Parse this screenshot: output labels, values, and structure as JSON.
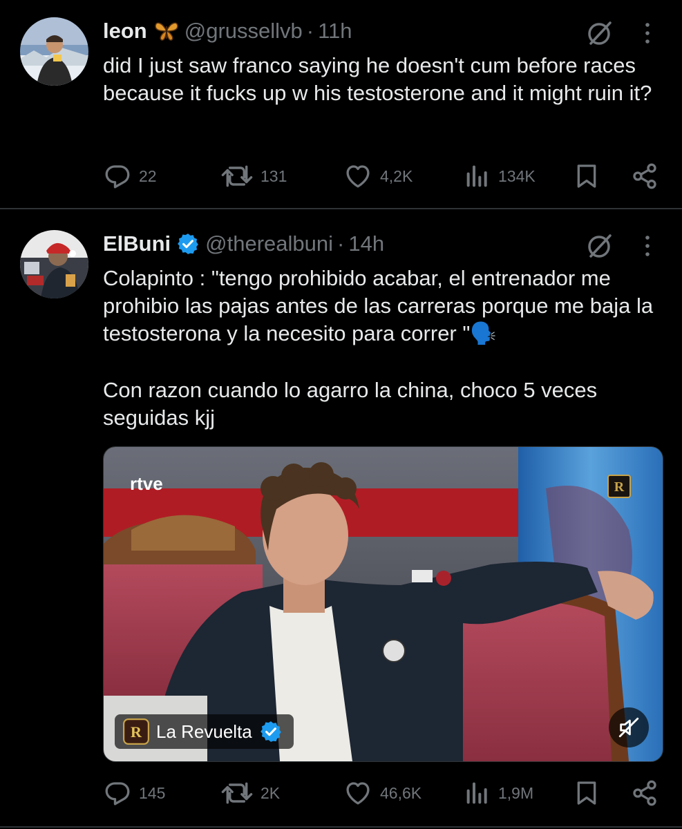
{
  "tweets": [
    {
      "author_name": "leon",
      "handle": "@grussellvb",
      "separator": "·",
      "time": "11h",
      "text": "did I just saw franco saying he doesn't cum before races because it fucks up w his testosterone and it might ruin it?",
      "replies": "22",
      "retweets": "131",
      "likes": "4,2K",
      "views": "134K"
    },
    {
      "author_name": "ElBuni",
      "handle": "@therealbuni",
      "separator": "·",
      "time": "14h",
      "text_p1": "Colapinto : \"tengo prohibido acabar, el entrenador me prohibio las pajas antes de las carreras porque me baja la testosterona y la necesito para correr \"🗣️",
      "text_p2": "Con razon cuando lo agarro la china, choco 5 veces seguidas kjj",
      "video": {
        "channel_logo": "rtve",
        "source_name": "La Revuelta"
      },
      "replies": "145",
      "retweets": "2K",
      "likes": "46,6K",
      "views": "1,9M"
    }
  ],
  "icons": [
    "grok-icon",
    "more-icon",
    "reply-icon",
    "retweet-icon",
    "like-icon",
    "views-icon",
    "bookmark-icon",
    "share-icon",
    "verified-badge-icon",
    "mute-icon"
  ],
  "colors": {
    "background": "#000000",
    "text": "#e7e9ea",
    "muted": "#71767b",
    "divider": "#2f3336",
    "verified": "#1d9bf0"
  }
}
